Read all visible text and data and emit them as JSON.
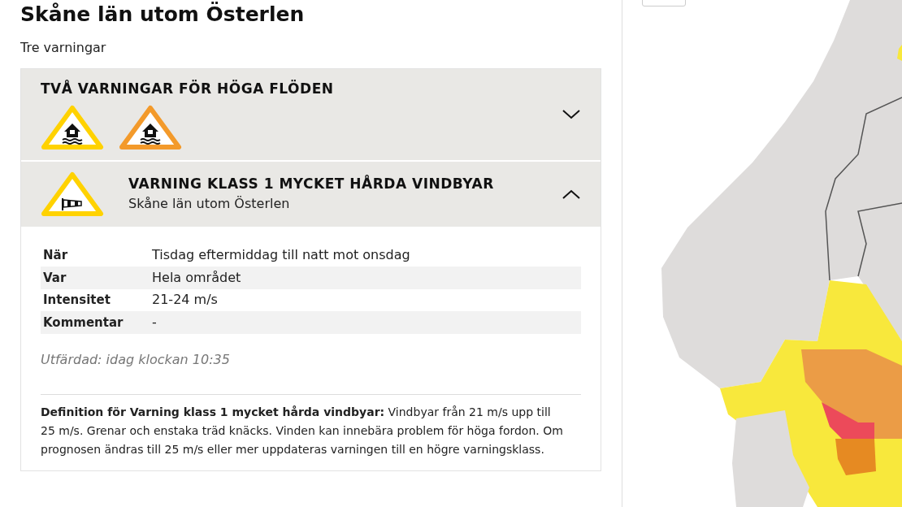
{
  "page": {
    "title": "Skåne län utom Österlen",
    "summary": "Tre varningar"
  },
  "warnings": [
    {
      "title": "TVÅ VARNINGAR FÖR HÖGA FLÖDEN",
      "expanded": false,
      "icons": [
        {
          "kind": "flood",
          "color": "#ffd200"
        },
        {
          "kind": "flood",
          "color": "#f39a2b"
        }
      ]
    },
    {
      "title": "VARNING KLASS 1 MYCKET HÅRDA VINDBYAR",
      "subtitle": "Skåne län utom Österlen",
      "expanded": true,
      "icons": [
        {
          "kind": "wind",
          "color": "#ffd200"
        }
      ],
      "details": [
        {
          "label": "När",
          "value": "Tisdag eftermiddag till natt mot onsdag"
        },
        {
          "label": "Var",
          "value": "Hela området"
        },
        {
          "label": "Intensitet",
          "value": "21-24 m/s"
        },
        {
          "label": "Kommentar",
          "value": "-"
        }
      ],
      "issued": "Utfärdad: idag klockan 10:35",
      "definition": "**Definition för Varning klass 1 mycket hårda vindbyar:**  Vindbyar från 21 m/s upp till 25 m/s. Grenar och enstaka träd knäcks. Vinden kan innebära problem för höga fordon. Om prognosen ändras till 25 m/s eller mer uppdateras varningen till en högre varningsklass."
    }
  ]
}
